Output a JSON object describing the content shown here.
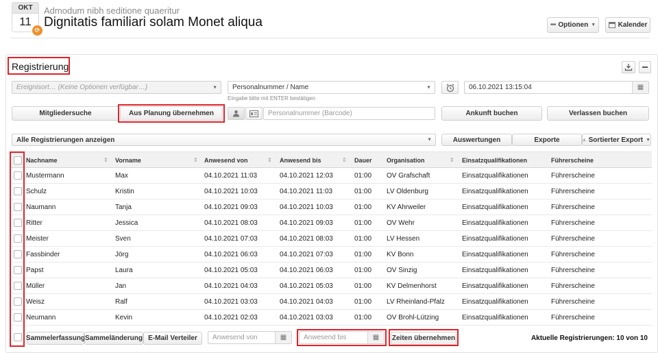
{
  "event": {
    "month": "OKT",
    "day": "11",
    "subtitle": "Admodum nibh seditione quaeritur",
    "title": "Dignitatis familiari solam Monet aliqua",
    "options_label": "Optionen",
    "calendar_label": "Kalender"
  },
  "panel": {
    "title": "Registrierung",
    "location_placeholder": "Ereignisort… (Keine Optionen verfügbar…)",
    "person_placeholder": "Personalnummer / Name",
    "person_hint": "Eingabe bitte mit ENTER bestätigen",
    "datetime_value": "06.10.2021 13:15:04",
    "member_search_label": "Mitgliedersuche",
    "from_planning_label": "Aus Planung übernehmen",
    "barcode_placeholder": "Personalnummer (Barcode)",
    "arrival_label": "Ankunft buchen",
    "leave_label": "Verlassen buchen",
    "filter_value": "Alle Registrierungen anzeigen",
    "evaluations_label": "Auswertungen",
    "exports_label": "Exporte",
    "sorted_export_label": "Sortierter Export"
  },
  "table": {
    "columns": [
      "Nachname",
      "Vorname",
      "Anwesend von",
      "Anwesend bis",
      "Dauer",
      "Organisation",
      "Einsatzqualifikationen",
      "Führerscheine"
    ],
    "rows": [
      [
        "Mustermann",
        "Max",
        "04.10.2021 11:03",
        "04.10.2021 12:03",
        "01:00",
        "OV Grafschaft",
        "Einsatzqualifikationen",
        "Führerscheine"
      ],
      [
        "Schulz",
        "Kristin",
        "04.10.2021 10:03",
        "04.10.2021 11:03",
        "01:00",
        "LV Oldenburg",
        "Einsatzqualifikationen",
        "Führerscheine"
      ],
      [
        "Naumann",
        "Tanja",
        "04.10.2021 09:03",
        "04.10.2021 10:03",
        "01:00",
        "KV Ahrweiler",
        "Einsatzqualifikationen",
        "Führerscheine"
      ],
      [
        "Ritter",
        "Jessica",
        "04.10.2021 08:03",
        "04.10.2021 09:03",
        "01:00",
        "OV Wehr",
        "Einsatzqualifikationen",
        "Führerscheine"
      ],
      [
        "Meister",
        "Sven",
        "04.10.2021 07:03",
        "04.10.2021 08:03",
        "01:00",
        "LV Hessen",
        "Einsatzqualifikationen",
        "Führerscheine"
      ],
      [
        "Fassbinder",
        "Jörg",
        "04.10.2021 06:03",
        "04.10.2021 07:03",
        "01:00",
        "KV Bonn",
        "Einsatzqualifikationen",
        "Führerscheine"
      ],
      [
        "Papst",
        "Laura",
        "04.10.2021 05:03",
        "04.10.2021 06:03",
        "01:00",
        "OV Sinzig",
        "Einsatzqualifikationen",
        "Führerscheine"
      ],
      [
        "Müller",
        "Jan",
        "04.10.2021 04:03",
        "04.10.2021 05:03",
        "01:00",
        "KV Delmenhorst",
        "Einsatzqualifikationen",
        "Führerscheine"
      ],
      [
        "Weisz",
        "Ralf",
        "04.10.2021 03:03",
        "04.10.2021 04:03",
        "01:00",
        "LV Rheinland-Pfalz",
        "Einsatzqualifikationen",
        "Führerscheine"
      ],
      [
        "Neumann",
        "Kevin",
        "04.10.2021 02:03",
        "04.10.2021 03:03",
        "01:00",
        "OV Brohl-Lützing",
        "Einsatzqualifikationen",
        "Führerscheine"
      ]
    ]
  },
  "footer": {
    "bulk_entry_label": "Sammelerfassung",
    "bulk_change_label": "Sammeländerung",
    "email_label": "E-Mail Verteiler",
    "from_placeholder": "Anwesend von",
    "to_placeholder": "Anwesend bis",
    "apply_times_label": "Zeiten übernehmen",
    "count_text": "Aktuelle Registrierungen: 10 von 10"
  },
  "colors": {
    "highlight": "#e0232a",
    "accent_orange": "#f0902a"
  },
  "icons": {
    "options": "dots-icon",
    "calendar": "calendar-icon",
    "download": "download-icon",
    "minimize": "minimize-icon",
    "clock": "alarm-clock-icon",
    "person": "person-icon",
    "id_card": "id-card-icon",
    "sort": "sort-icon"
  }
}
